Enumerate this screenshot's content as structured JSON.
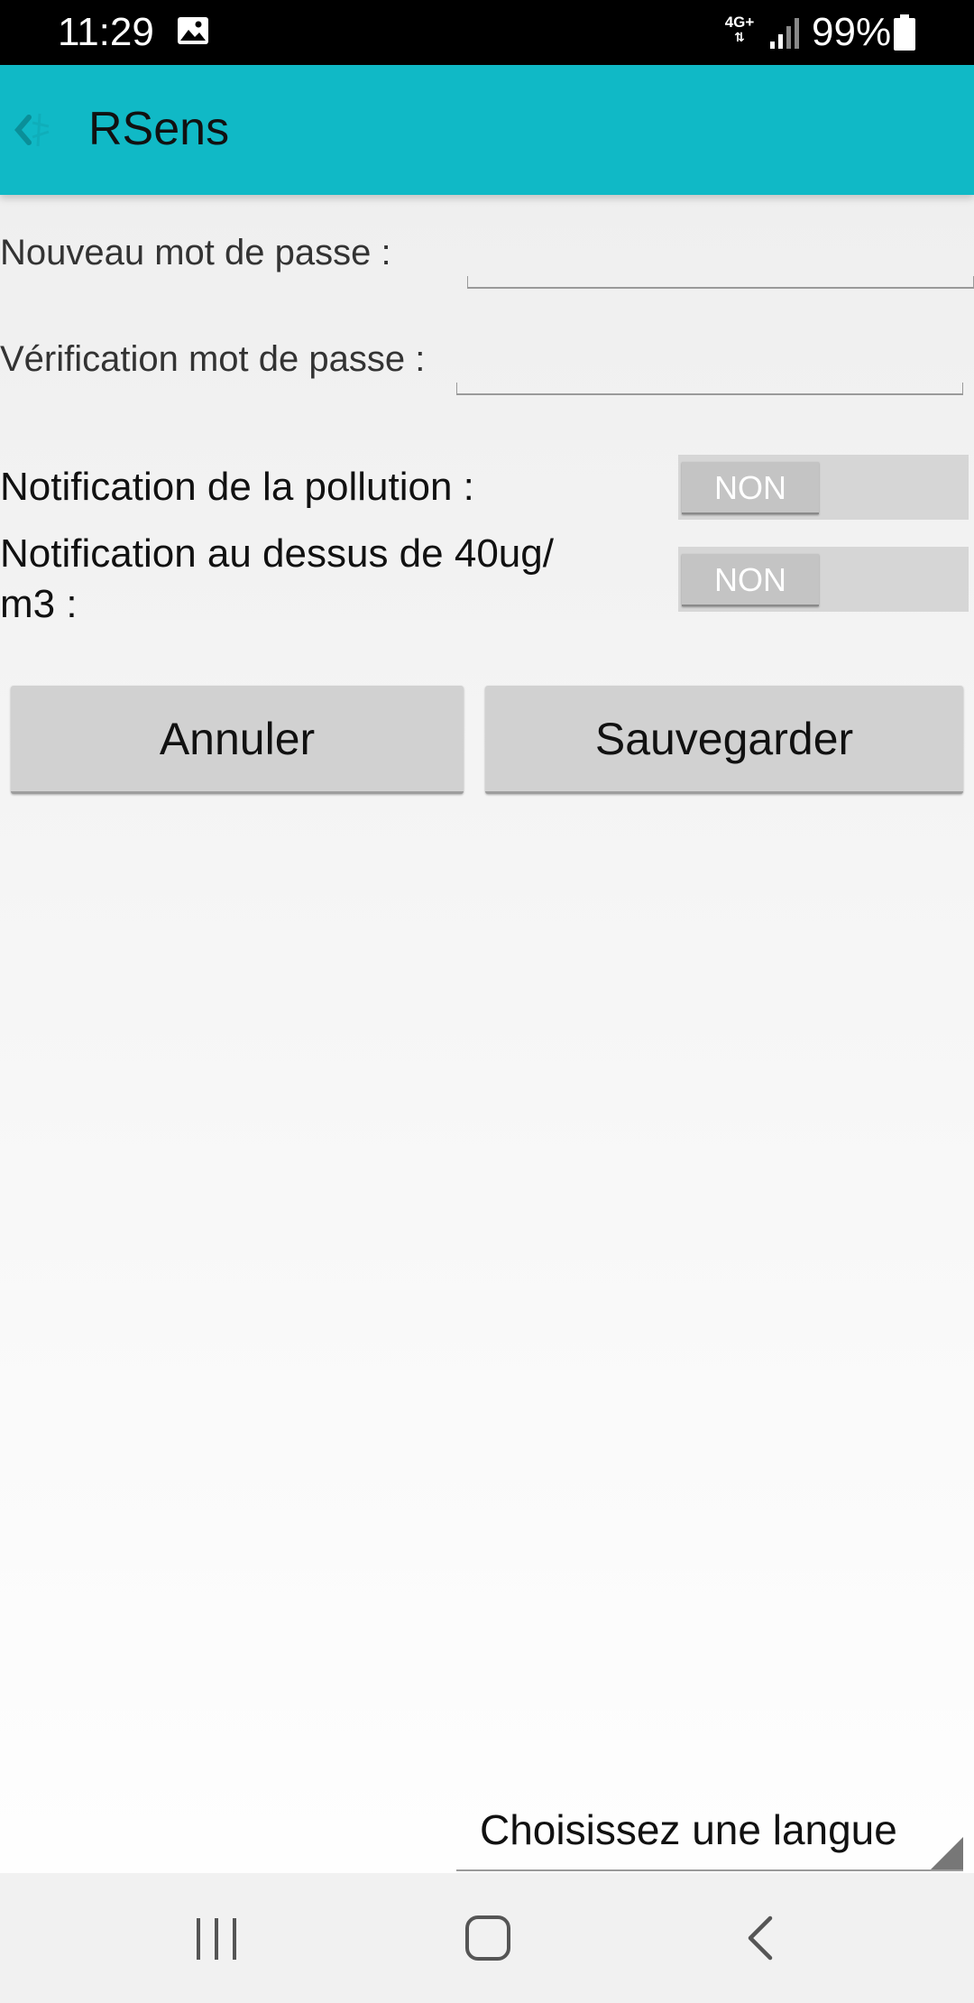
{
  "status_bar": {
    "time": "11:29",
    "network": "4G+",
    "battery": "99%"
  },
  "app_bar": {
    "title": "RSens",
    "accent_color": "#10b9c6"
  },
  "form": {
    "new_password_label": "Nouveau mot de passe :",
    "new_password_value": "",
    "verify_password_label": "Vérification mot de passe :",
    "verify_password_value": ""
  },
  "notifications": {
    "pollution_label": "Notification de la pollution :",
    "pollution_state": "NON",
    "threshold_label_line1": "Notification au dessus de 40ug/",
    "threshold_label_line2": "m3 :",
    "threshold_state": "NON"
  },
  "actions": {
    "cancel_label": "Annuler",
    "save_label": "Sauvegarder"
  },
  "language": {
    "selected": "Choisissez une langue"
  },
  "nav_icons": [
    "recents-icon",
    "home-icon",
    "back-icon"
  ]
}
